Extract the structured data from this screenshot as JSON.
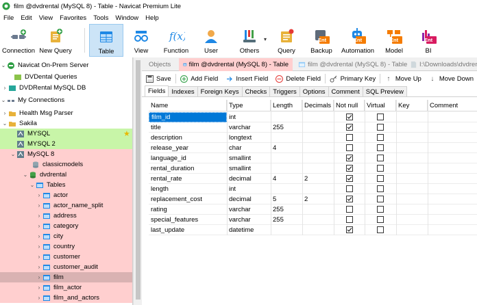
{
  "window": {
    "title": "film @dvdrental (MySQL 8) - Table - Navicat Premium Lite"
  },
  "menu": [
    "File",
    "Edit",
    "View",
    "Favorites",
    "Tools",
    "Window",
    "Help"
  ],
  "toolbar": {
    "connection": "Connection",
    "new_query": "New Query",
    "table": "Table",
    "view": "View",
    "function": "Function",
    "user": "User",
    "others": "Others",
    "query": "Query",
    "backup": "Backup",
    "automation": "Automation",
    "model": "Model",
    "bi": "BI",
    "ent_badge": "Ent",
    "bi_badge": "Ent"
  },
  "tree": {
    "navicat_server": "Navicat On-Prem Server",
    "dvdental_queries": "DVDental Queries",
    "dvdrental_mysql_db": "DVDRental MySQL DB",
    "my_connections": "My Connections",
    "health_msg_parser": "Health Msg Parser",
    "sakila": "Sakila",
    "mysql": "MYSQL",
    "mysql2": "MYSQL 2",
    "mysql8": "MySQL 8",
    "classicmodels": "classicmodels",
    "dvdrental": "dvdrental",
    "tables": "Tables",
    "table_items": [
      "actor",
      "actor_name_split",
      "address",
      "category",
      "city",
      "country",
      "customer",
      "customer_audit",
      "film",
      "film_actor",
      "film_and_actors"
    ]
  },
  "tabs": {
    "objects": "Objects",
    "active_tab": "film @dvdrental (MySQL 8) - Table",
    "second_tab": "film @dvdrental (MySQL 8) - Table",
    "third_tab": "I:\\Downloads\\dvdren"
  },
  "subtoolbar": {
    "save": "Save",
    "add_field": "Add Field",
    "insert_field": "Insert Field",
    "delete_field": "Delete Field",
    "primary_key": "Primary Key",
    "move_up": "Move Up",
    "move_down": "Move Down"
  },
  "design_tabs": [
    "Fields",
    "Indexes",
    "Foreign Keys",
    "Checks",
    "Triggers",
    "Options",
    "Comment",
    "SQL Preview"
  ],
  "grid": {
    "headers": [
      "Name",
      "Type",
      "Length",
      "Decimals",
      "Not null",
      "Virtual",
      "Key",
      "Comment"
    ],
    "rows": [
      {
        "name": "film_id",
        "type": "int",
        "length": "",
        "decimals": "",
        "not_null": true,
        "virtual": false
      },
      {
        "name": "title",
        "type": "varchar",
        "length": "255",
        "decimals": "",
        "not_null": true,
        "virtual": false
      },
      {
        "name": "description",
        "type": "longtext",
        "length": "",
        "decimals": "",
        "not_null": false,
        "virtual": false
      },
      {
        "name": "release_year",
        "type": "char",
        "length": "4",
        "decimals": "",
        "not_null": false,
        "virtual": false
      },
      {
        "name": "language_id",
        "type": "smallint",
        "length": "",
        "decimals": "",
        "not_null": true,
        "virtual": false
      },
      {
        "name": "rental_duration",
        "type": "smallint",
        "length": "",
        "decimals": "",
        "not_null": true,
        "virtual": false
      },
      {
        "name": "rental_rate",
        "type": "decimal",
        "length": "4",
        "decimals": "2",
        "not_null": true,
        "virtual": false
      },
      {
        "name": "length",
        "type": "int",
        "length": "",
        "decimals": "",
        "not_null": false,
        "virtual": false
      },
      {
        "name": "replacement_cost",
        "type": "decimal",
        "length": "5",
        "decimals": "2",
        "not_null": true,
        "virtual": false
      },
      {
        "name": "rating",
        "type": "varchar",
        "length": "255",
        "decimals": "",
        "not_null": false,
        "virtual": false
      },
      {
        "name": "special_features",
        "type": "varchar",
        "length": "255",
        "decimals": "",
        "not_null": false,
        "virtual": false
      },
      {
        "name": "last_update",
        "type": "datetime",
        "length": "",
        "decimals": "",
        "not_null": true,
        "virtual": false
      }
    ]
  },
  "colors": {
    "selected_blue": "#0078d7",
    "green_row": "#c8f5a8",
    "red_row": "#ffcfcf",
    "active_tab": "#ffcfcf"
  }
}
